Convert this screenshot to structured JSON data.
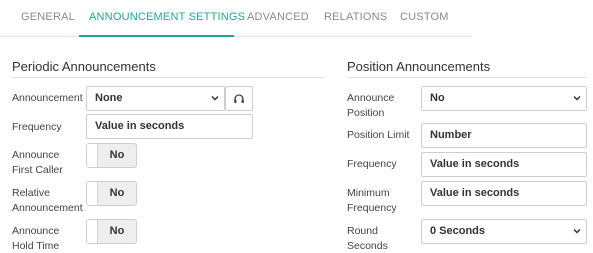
{
  "tabs": [
    {
      "label": "GENERAL"
    },
    {
      "label": "ANNOUNCEMENT SETTINGS",
      "active": true
    },
    {
      "label": "ADVANCED"
    },
    {
      "label": "RELATIONS"
    },
    {
      "label": "CUSTOM"
    }
  ],
  "periodic": {
    "title": "Periodic Announcements",
    "announcement_label": "Announcement",
    "announcement_value": "None",
    "frequency_label": "Frequency",
    "frequency_placeholder": "Value in seconds",
    "first_caller_label_1": "Announce",
    "first_caller_label_2": "First Caller",
    "first_caller_value": "No",
    "relative_label_1": "Relative",
    "relative_label_2": "Announcement",
    "relative_value": "No",
    "hold_time_label_1": "Announce",
    "hold_time_label_2": "Hold Time",
    "hold_time_value": "No"
  },
  "position": {
    "title": "Position Announcements",
    "announce_position_label_1": "Announce",
    "announce_position_label_2": "Position",
    "announce_position_value": "No",
    "limit_label": "Position Limit",
    "limit_placeholder": "Number",
    "frequency_label": "Frequency",
    "frequency_placeholder": "Value in seconds",
    "min_freq_label_1": "Minimum",
    "min_freq_label_2": "Frequency",
    "min_freq_placeholder": "Value in seconds",
    "round_label_1": "Round",
    "round_label_2": "Seconds",
    "round_value": "0 Seconds"
  },
  "colors": {
    "accent": "#23a49a",
    "tab_inactive": "#8a8a8a"
  },
  "icons": {
    "announcement_play": "headset-icon"
  }
}
